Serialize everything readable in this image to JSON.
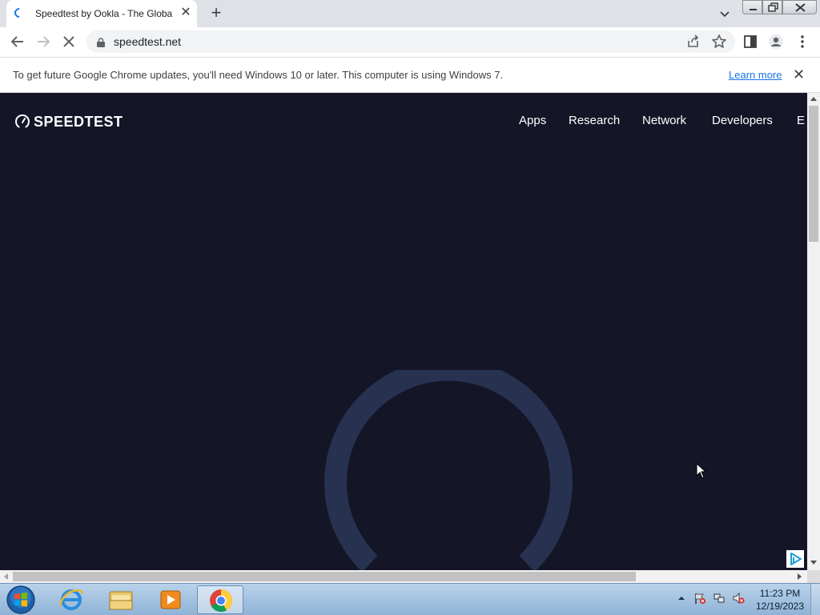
{
  "browser": {
    "tab": {
      "title": "Speedtest by Ookla - The Global Broadband Speed Test",
      "close": "✕"
    },
    "new_tab": "+",
    "url": "speedtest.net"
  },
  "infobar": {
    "message": "To get future Google Chrome updates, you'll need Windows 10 or later. This computer is using Windows 7.",
    "link": "Learn more",
    "close": "✕"
  },
  "site": {
    "logo_text": "SPEEDTEST",
    "nav": [
      "Apps",
      "Research",
      "Network",
      "Developers",
      "E"
    ],
    "background": "#141526",
    "gauge_color": "#26324f"
  },
  "taskbar": {
    "time": "11:23 PM",
    "date": "12/19/2023"
  }
}
